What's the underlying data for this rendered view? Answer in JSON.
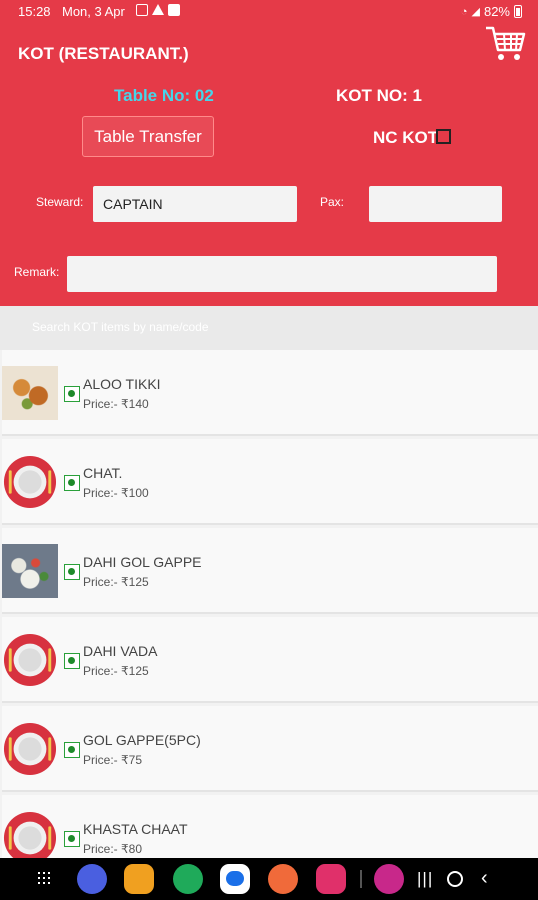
{
  "status_bar": {
    "time": "15:28",
    "date": "Mon, 3 Apr",
    "battery": "82%"
  },
  "header": {
    "title": "KOT (RESTAURANT.)",
    "table_no": "Table No: 02",
    "kot_no": "KOT NO: 1",
    "table_transfer_label": "Table Transfer",
    "nc_kot_label": "NC KOT",
    "nc_kot_checked": false,
    "steward_label": "Steward:",
    "steward_value": "CAPTAIN",
    "pax_label": "Pax:",
    "pax_value": "",
    "remark_label": "Remark:",
    "remark_value": ""
  },
  "search": {
    "placeholder": "Search KOT items by name/code"
  },
  "items": [
    {
      "name": "ALOO TIKKI",
      "price": "Price:- ₹140",
      "thumb": "photo-aloo-tikki"
    },
    {
      "name": "CHAT.",
      "price": "Price:- ₹100",
      "thumb": "plate-icon"
    },
    {
      "name": "DAHI GOL GAPPE",
      "price": "Price:- ₹125",
      "thumb": "photo-dahi-gol-gappe"
    },
    {
      "name": "DAHI VADA",
      "price": "Price:- ₹125",
      "thumb": "plate-icon"
    },
    {
      "name": "GOL GAPPE(5PC)",
      "price": "Price:- ₹75",
      "thumb": "plate-icon"
    },
    {
      "name": "KHASTA CHAAT",
      "price": "Price:- ₹80",
      "thumb": "plate-icon"
    }
  ],
  "colors": {
    "header_bg": "#e53a48",
    "table_no_text": "#45d6ea",
    "veg_indicator": "#1e8a2a"
  }
}
